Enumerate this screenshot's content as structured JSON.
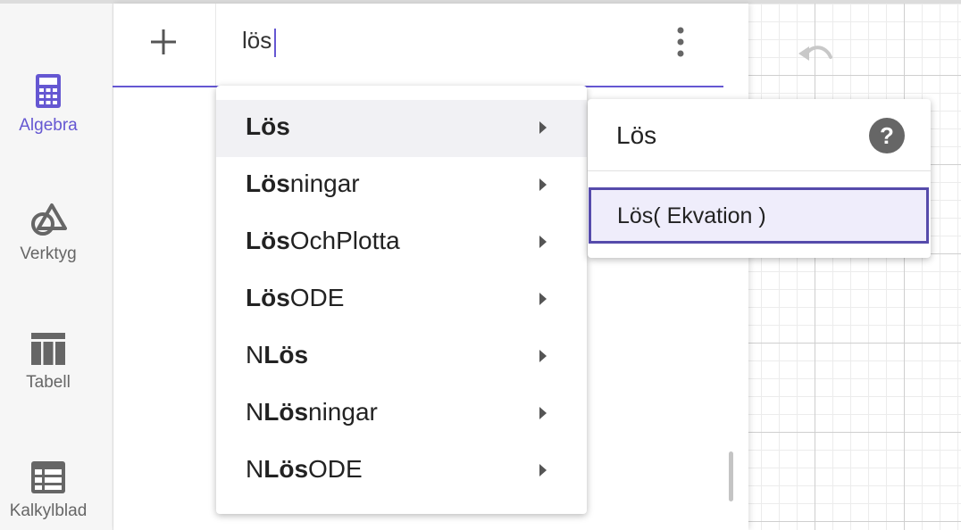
{
  "sidebar": {
    "items": [
      {
        "label": "Algebra",
        "icon": "calculator-icon",
        "active": true
      },
      {
        "label": "Verktyg",
        "icon": "shapes-tool-icon",
        "active": false
      },
      {
        "label": "Tabell",
        "icon": "table-icon",
        "active": false
      },
      {
        "label": "Kalkylblad",
        "icon": "spreadsheet-icon",
        "active": false
      }
    ]
  },
  "input": {
    "value": "lös"
  },
  "suggestions": [
    {
      "pre": "",
      "bold": "Lös",
      "post": ""
    },
    {
      "pre": "",
      "bold": "Lös",
      "post": "ningar"
    },
    {
      "pre": "",
      "bold": "Lös",
      "post": "OchPlotta"
    },
    {
      "pre": "",
      "bold": "Lös",
      "post": "ODE"
    },
    {
      "pre": "N",
      "bold": "Lös",
      "post": ""
    },
    {
      "pre": "N",
      "bold": "Lös",
      "post": "ningar"
    },
    {
      "pre": "N",
      "bold": "Lös",
      "post": "ODE"
    }
  ],
  "help_popup": {
    "title": "Lös",
    "help_icon_glyph": "?",
    "syntax": "Lös( Ekvation )"
  },
  "colors": {
    "accent": "#6557d2",
    "syntax_border": "#564bab",
    "syntax_bg": "#efedfb"
  }
}
